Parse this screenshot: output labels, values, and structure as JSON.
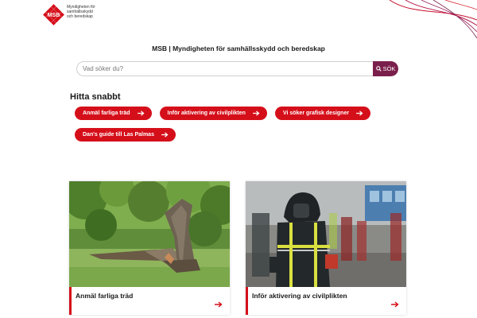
{
  "brand": {
    "logo_text": "MSB",
    "logo_lines": [
      "Myndigheten för",
      "samhällsskydd",
      "och beredskap"
    ]
  },
  "site_title": "MSB | Myndigheten för samhällsskydd och beredskap",
  "search": {
    "placeholder": "Vad söker du?",
    "button_label": "SÖK"
  },
  "quick_links": {
    "heading": "Hitta snabbt",
    "items": [
      {
        "label": "Anmäl farliga träd"
      },
      {
        "label": "Inför aktivering av civilplikten"
      },
      {
        "label": "Vi söker grafisk designer"
      },
      {
        "label": "Dan's guide till Las Palmas"
      }
    ]
  },
  "cards": [
    {
      "title": "Anmäl farliga träd",
      "image": "fallen-tree-photo"
    },
    {
      "title": "Inför aktivering av civilplikten",
      "image": "firefighter-photo"
    }
  ],
  "colors": {
    "accent_red": "#d50f1a",
    "search_button": "#7a1f4c"
  }
}
